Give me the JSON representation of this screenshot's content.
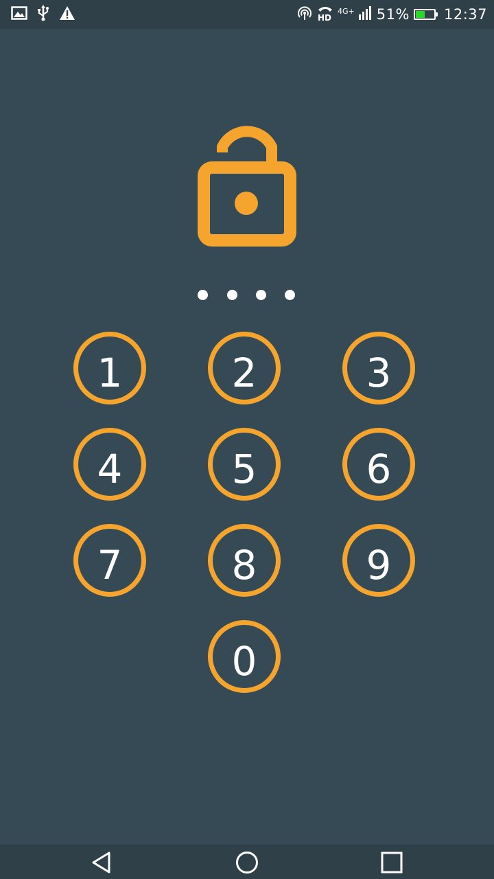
{
  "status_bar": {
    "left_icons": [
      "image-icon",
      "usb-icon",
      "warning-icon"
    ],
    "right_icons": [
      "hotspot-icon",
      "hd-call-icon",
      "signal-icon",
      "battery-icon"
    ],
    "network": "4G+",
    "battery_percent": "51%",
    "battery_level": 0.51,
    "time": "12:37"
  },
  "lock": {
    "icon": "unlocked-padlock-icon",
    "accent_color": "#f5a42e"
  },
  "pin": {
    "length": 4
  },
  "keypad": {
    "keys": [
      {
        "label": "1"
      },
      {
        "label": "2"
      },
      {
        "label": "3"
      },
      {
        "label": "4"
      },
      {
        "label": "5"
      },
      {
        "label": "6"
      },
      {
        "label": "7"
      },
      {
        "label": "8"
      },
      {
        "label": "9"
      },
      {
        "label": "0"
      }
    ]
  },
  "nav_bar": {
    "buttons": [
      "back-icon",
      "home-icon",
      "recents-icon"
    ]
  },
  "colors": {
    "background": "#354a54",
    "bars": "#2f4049",
    "accent": "#f5a42e",
    "text": "#ffffff",
    "battery": "#2bd62b"
  }
}
